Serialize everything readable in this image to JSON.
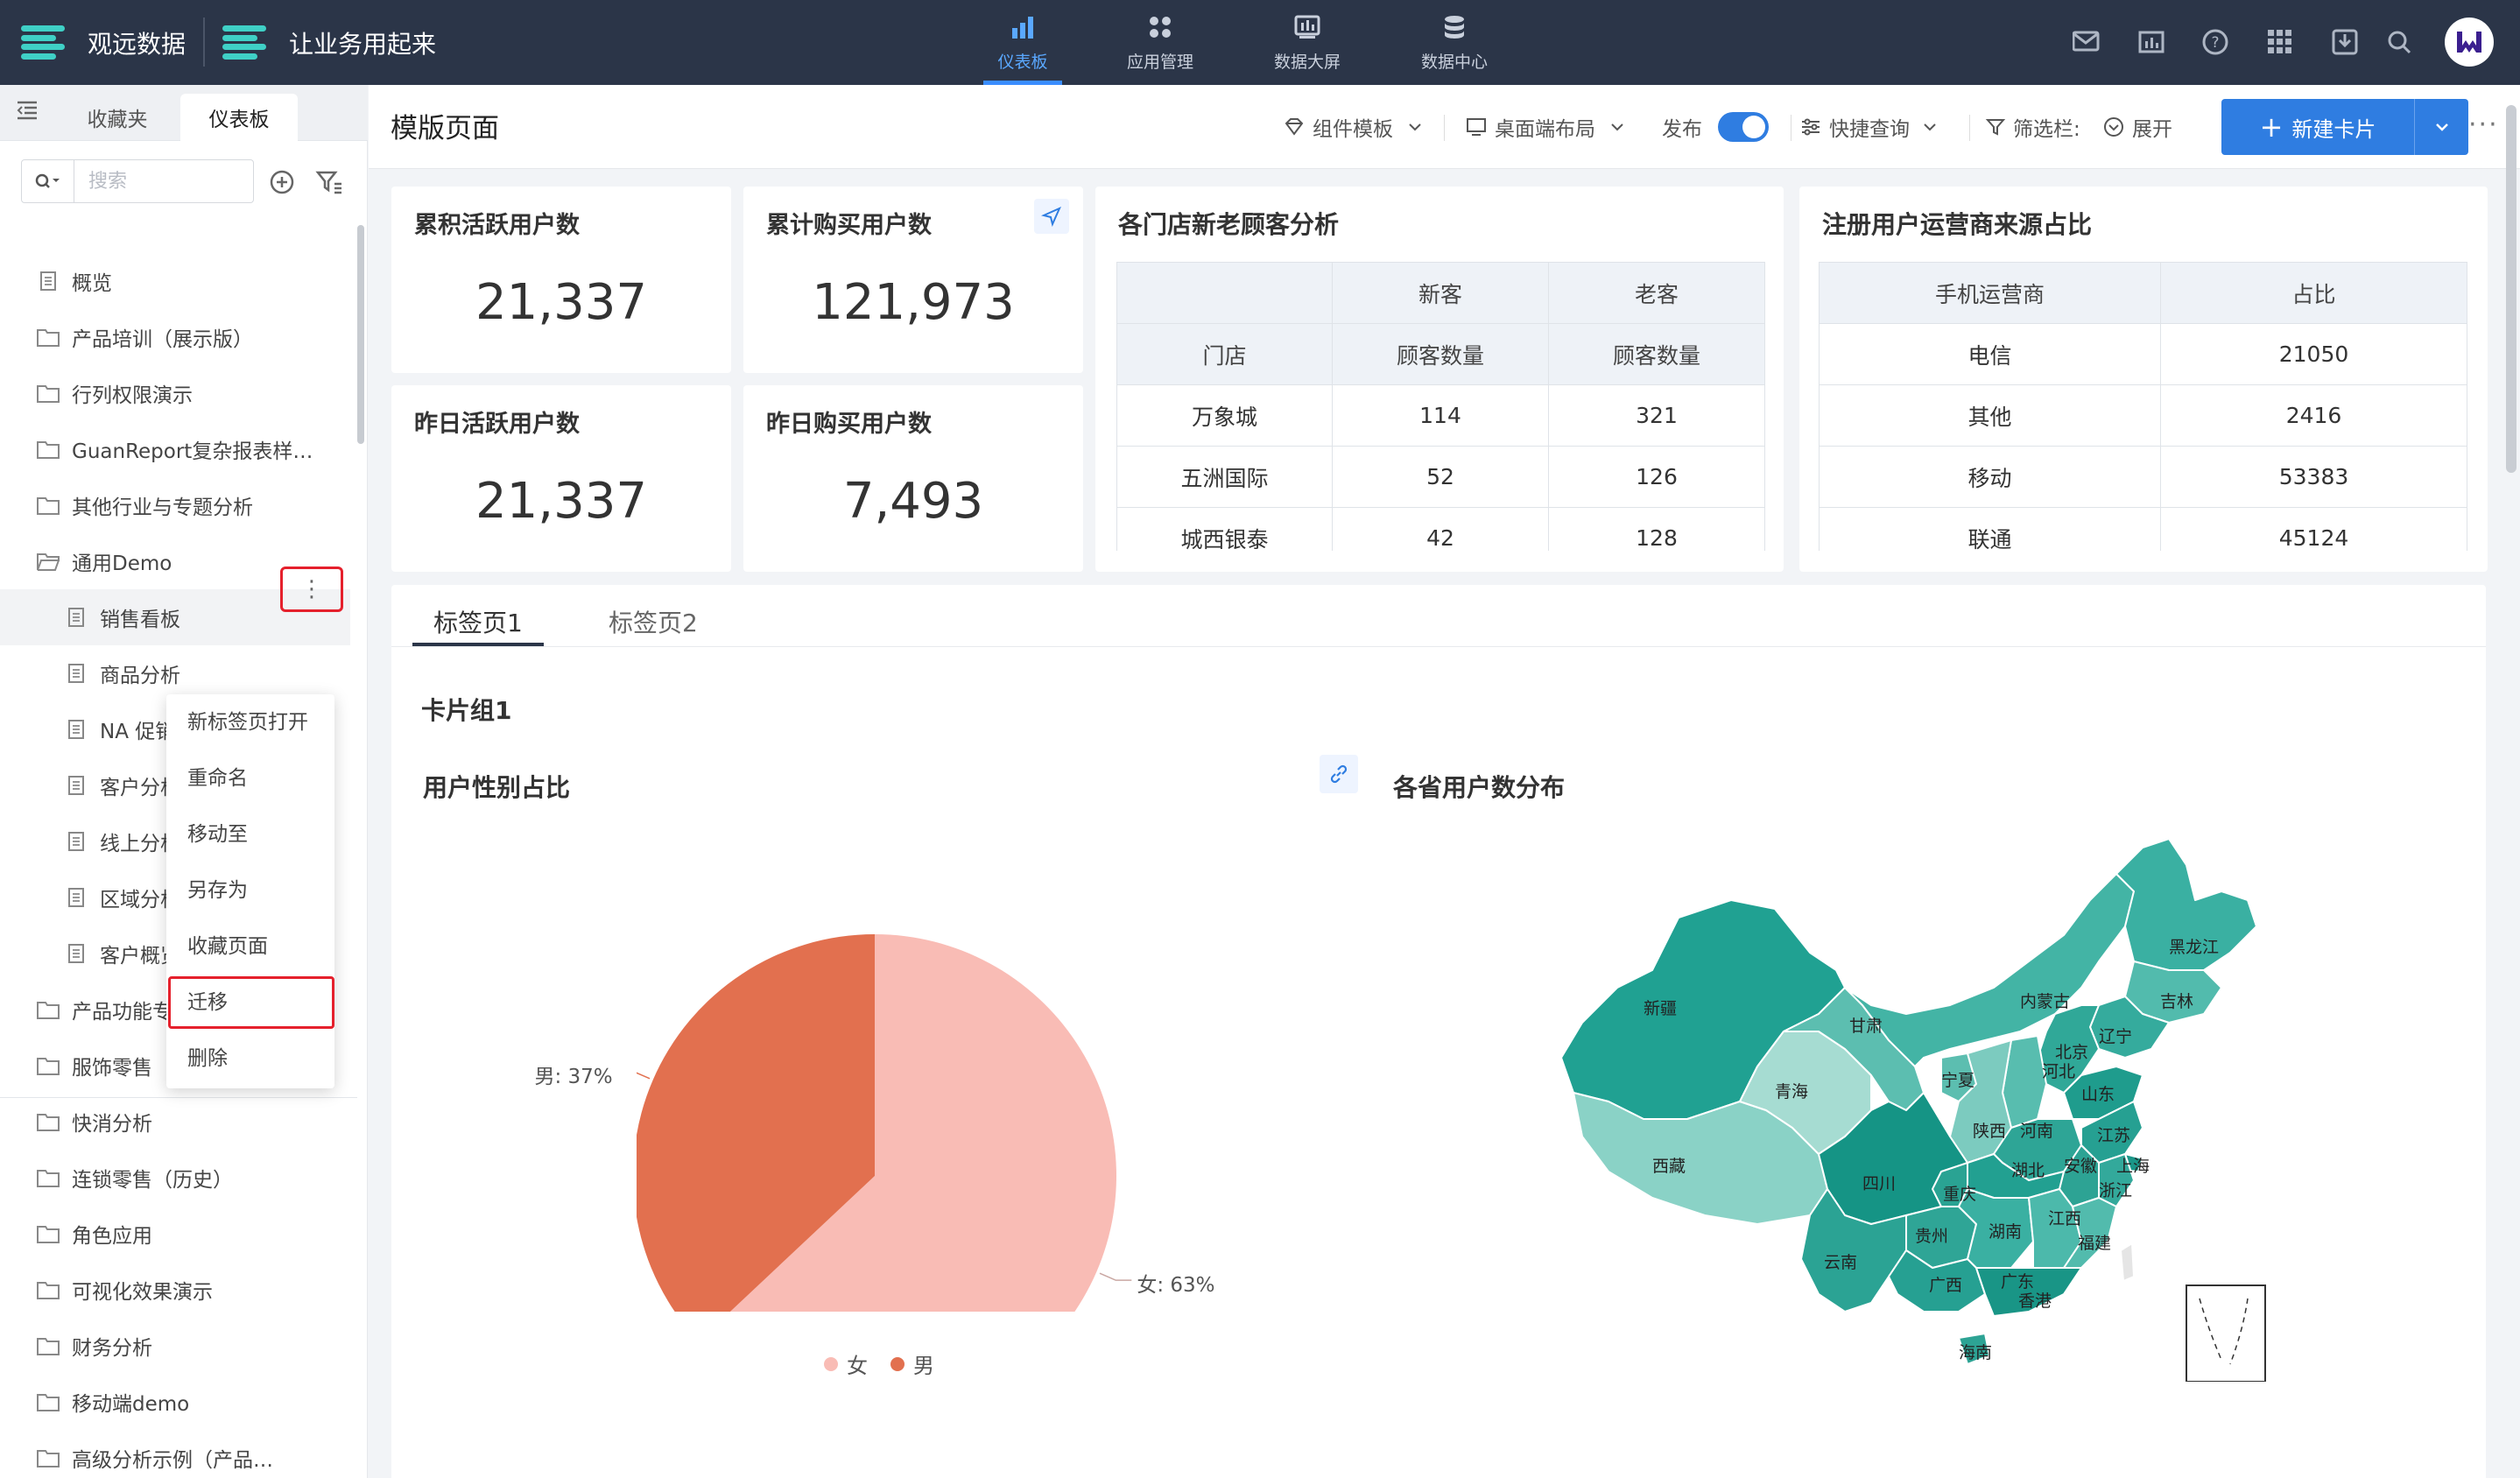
{
  "topbar": {
    "app_name": "观远数据",
    "subtitle": "让业务用起来",
    "nav": [
      {
        "label": "仪表板",
        "icon": "bar-chart-icon",
        "active": true
      },
      {
        "label": "应用管理",
        "icon": "apps-icon",
        "active": false
      },
      {
        "label": "数据大屏",
        "icon": "screen-icon",
        "active": false
      },
      {
        "label": "数据中心",
        "icon": "database-icon",
        "active": false
      }
    ],
    "right_icons": [
      "mail-icon",
      "report-icon",
      "help-icon",
      "grid-icon",
      "inbox-icon",
      "search-icon",
      "user-avatar"
    ]
  },
  "sidebar": {
    "tabs": [
      "收藏夹",
      "仪表板"
    ],
    "active_tab": "仪表板",
    "search_placeholder": "搜索",
    "tree": [
      {
        "label": "概览",
        "type": "page"
      },
      {
        "label": "产品培训（展示版）",
        "type": "folder"
      },
      {
        "label": "行列权限演示",
        "type": "folder"
      },
      {
        "label": "GuanReport复杂报表样…",
        "type": "folder"
      },
      {
        "label": "其他行业与专题分析",
        "type": "folder"
      },
      {
        "label": "通用Demo",
        "type": "folder-open"
      },
      {
        "label": "销售看板",
        "type": "page"
      },
      {
        "label": "商品分析",
        "type": "page"
      },
      {
        "label": "NA 促销",
        "type": "page"
      },
      {
        "label": "客户分析",
        "type": "page"
      },
      {
        "label": "线上分析",
        "type": "page"
      },
      {
        "label": "区域分析",
        "type": "page"
      },
      {
        "label": "客户概览",
        "type": "page"
      },
      {
        "label": "产品功能专",
        "type": "folder"
      },
      {
        "label": "服饰零售",
        "type": "folder"
      },
      {
        "label": "快消分析",
        "type": "folder"
      },
      {
        "label": "连锁零售（历史）",
        "type": "folder"
      },
      {
        "label": "角色应用",
        "type": "folder"
      },
      {
        "label": "可视化效果演示",
        "type": "folder"
      },
      {
        "label": "财务分析",
        "type": "folder"
      },
      {
        "label": "移动端demo",
        "type": "folder"
      },
      {
        "label": "高级分析示例（产品…",
        "type": "folder"
      }
    ],
    "context_menu": [
      "新标签页打开",
      "重命名",
      "移动至",
      "另存为",
      "收藏页面",
      "迁移",
      "删除"
    ],
    "more_glyph": "⋮"
  },
  "header": {
    "title": "模版页面",
    "component_template": "组件模板",
    "layout": "桌面端布局",
    "publish": "发布",
    "quick_query": "快捷查询",
    "filter_bar": "筛选栏:",
    "expand": "展开",
    "new_card": "新建卡片",
    "more": "···"
  },
  "kpis": [
    {
      "label": "累积活跃用户数",
      "value": "21,337"
    },
    {
      "label": "累计购买用户数",
      "value": "121,973"
    },
    {
      "label": "昨日活跃用户数",
      "value": "21,337"
    },
    {
      "label": "昨日购买用户数",
      "value": "7,493"
    }
  ],
  "store_table": {
    "title": "各门店新老顾客分析",
    "group_headers": [
      "",
      "新客",
      "老客"
    ],
    "sub_headers": [
      "门店",
      "顾客数量",
      "顾客数量"
    ],
    "rows": [
      [
        "万象城",
        "114",
        "321"
      ],
      [
        "五洲国际",
        "52",
        "126"
      ],
      [
        "城西银泰",
        "42",
        "128"
      ]
    ]
  },
  "carrier_table": {
    "title": "注册用户运营商来源占比",
    "headers": [
      "手机运营商",
      "占比"
    ],
    "rows": [
      [
        "电信",
        "21050"
      ],
      [
        "其他",
        "2416"
      ],
      [
        "移动",
        "53383"
      ],
      [
        "联通",
        "45124"
      ]
    ]
  },
  "bottom": {
    "tabs": [
      "标签页1",
      "标签页2"
    ],
    "group_title": "卡片组1",
    "pie_title": "用户性别占比",
    "map_title": "各省用户数分布"
  },
  "chart_data": {
    "type": "pie",
    "title": "用户性别占比",
    "categories": [
      "女",
      "男"
    ],
    "values": [
      63,
      37
    ],
    "labels": [
      "女: 63%",
      "男: 37%"
    ],
    "colors": [
      "#f9bcb5",
      "#e2704f"
    ],
    "legend": "bottom"
  },
  "map": {
    "provinces": [
      "新疆",
      "西藏",
      "青海",
      "甘肃",
      "内蒙古",
      "黑龙江",
      "吉林",
      "辽宁",
      "北京",
      "河北",
      "宁夏",
      "山东",
      "陕西",
      "河南",
      "江苏",
      "四川",
      "湖北",
      "安徽",
      "上海",
      "重庆",
      "浙江",
      "贵州",
      "湖南",
      "江西",
      "云南",
      "福建",
      "广西",
      "广东",
      "香港",
      "海南"
    ]
  }
}
